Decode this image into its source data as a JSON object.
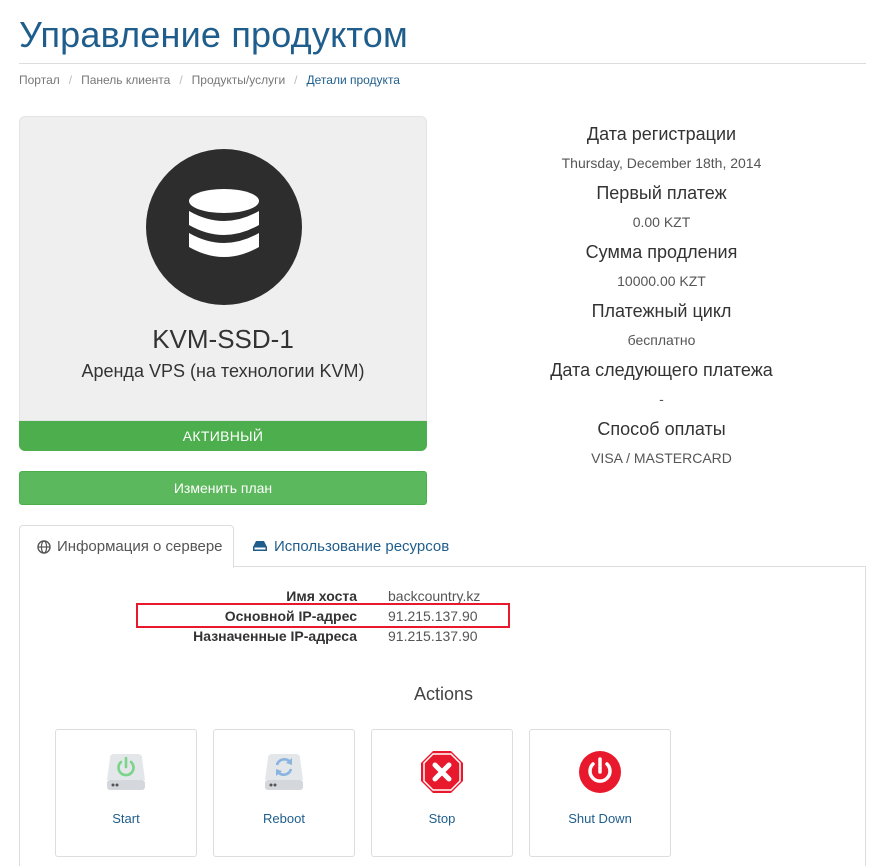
{
  "page": {
    "title": "Управление продуктом"
  },
  "breadcrumb": [
    {
      "label": "Портал"
    },
    {
      "label": "Панель клиента"
    },
    {
      "label": "Продукты/услуги"
    },
    {
      "label": "Детали продукта"
    }
  ],
  "product": {
    "icon": "database-icon",
    "name": "KVM-SSD-1",
    "group": "Аренда VPS (на технологии KVM)",
    "status": "АКТИВНЫЙ",
    "change_plan_label": "Изменить план",
    "colors": {
      "status": "#4cae4c",
      "button": "#5cb85c",
      "icon_circle": "#2d2d2d"
    }
  },
  "details": [
    {
      "label": "Дата регистрации",
      "value": "Thursday, December 18th, 2014"
    },
    {
      "label": "Первый платеж",
      "value": "0.00 KZT"
    },
    {
      "label": "Сумма продления",
      "value": "10000.00 KZT"
    },
    {
      "label": "Платежный цикл",
      "value": "бесплатно"
    },
    {
      "label": "Дата следующего платежа",
      "value": "-"
    },
    {
      "label": "Способ оплаты",
      "value": "VISA / MASTERCARD"
    }
  ],
  "tabs": [
    {
      "label": "Информация о сервере",
      "icon": "globe-icon",
      "active": true
    },
    {
      "label": "Использование ресурсов",
      "icon": "hdd-icon",
      "active": false
    }
  ],
  "server_info": [
    {
      "key": "Имя хоста",
      "value": "backcountry.kz"
    },
    {
      "key": "Основной IP-адрес",
      "value": "91.215.137.90",
      "highlighted": true
    },
    {
      "key": "Назначенные IP-адреса",
      "value": "91.215.137.90"
    }
  ],
  "actions": {
    "title": "Actions",
    "items": [
      {
        "label": "Start",
        "icon": "power-drive-icon"
      },
      {
        "label": "Reboot",
        "icon": "reboot-drive-icon"
      },
      {
        "label": "Stop",
        "icon": "stop-icon"
      },
      {
        "label": "Shut Down",
        "icon": "power-icon"
      }
    ]
  },
  "colors": {
    "brand": "#1f5e8c",
    "highlight": "#e8192c",
    "stop": "#e8192c"
  }
}
